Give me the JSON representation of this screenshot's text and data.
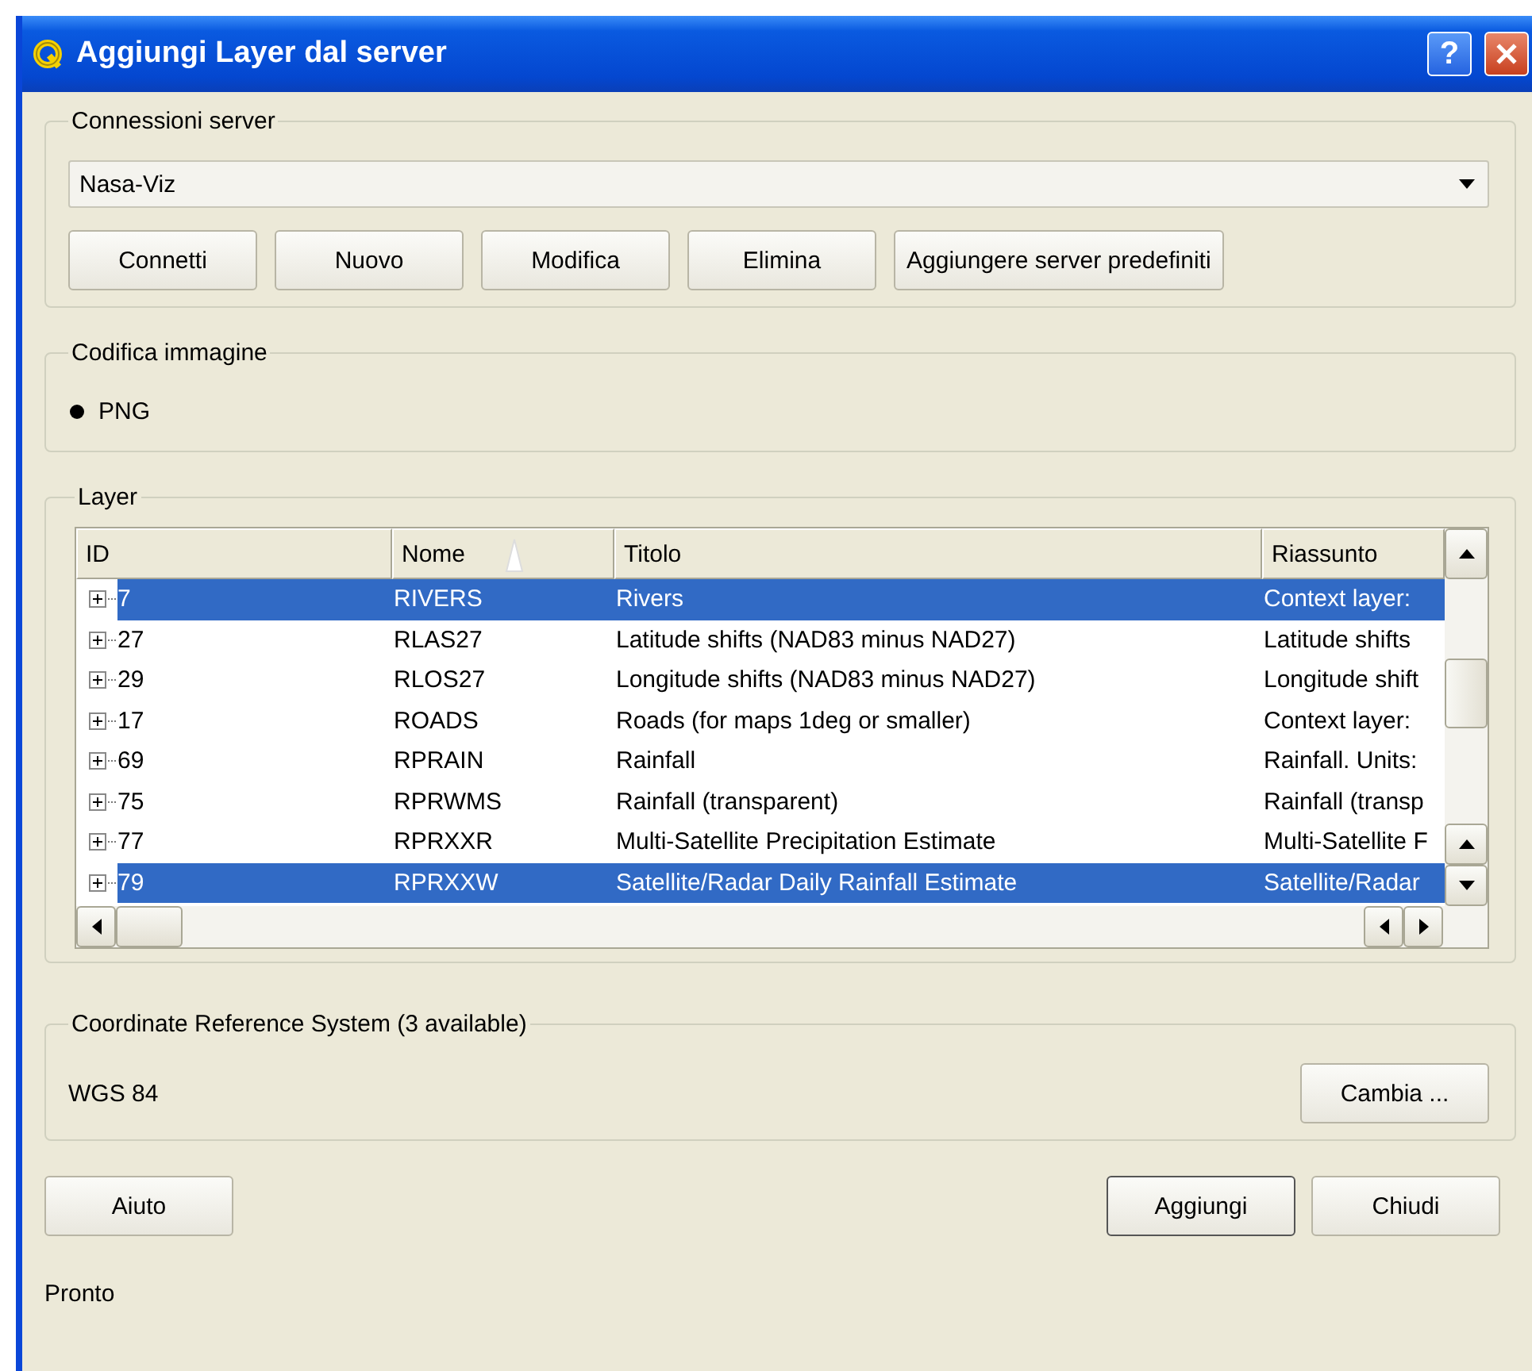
{
  "window": {
    "title": "Aggiungi Layer dal server",
    "help": "?"
  },
  "connections": {
    "label": "Connessioni server",
    "selected_server": "Nasa-Viz",
    "buttons": [
      "Connetti",
      "Nuovo",
      "Modifica",
      "Elimina",
      "Aggiungere server predefiniti"
    ]
  },
  "encoding": {
    "label": "Codifica immagine",
    "options": [
      {
        "label": "PNG",
        "selected": true
      }
    ]
  },
  "layers": {
    "label": "Layer",
    "columns": [
      "ID",
      "Nome",
      "Titolo",
      "Riassunto"
    ],
    "rows": [
      {
        "id": "7",
        "name": "RIVERS",
        "title": "Rivers",
        "summary": "Context layer:",
        "selected": true,
        "expanded": false
      },
      {
        "id": "27",
        "name": "RLAS27",
        "title": "Latitude shifts (NAD83 minus NAD27)",
        "summary": "Latitude shifts",
        "selected": false,
        "expanded": false
      },
      {
        "id": "29",
        "name": "RLOS27",
        "title": "Longitude shifts (NAD83 minus NAD27)",
        "summary": "Longitude shift",
        "selected": false,
        "expanded": false
      },
      {
        "id": "17",
        "name": "ROADS",
        "title": "Roads (for maps 1deg or smaller)",
        "summary": "Context layer:",
        "selected": false,
        "expanded": false
      },
      {
        "id": "69",
        "name": "RPRAIN",
        "title": "Rainfall",
        "summary": "Rainfall. Units:",
        "selected": false,
        "expanded": false
      },
      {
        "id": "75",
        "name": "RPRWMS",
        "title": "Rainfall (transparent)",
        "summary": "Rainfall (transp",
        "selected": false,
        "expanded": false
      },
      {
        "id": "77",
        "name": "RPRXXR",
        "title": "Multi-Satellite Precipitation Estimate",
        "summary": "Multi-Satellite F",
        "selected": false,
        "expanded": false
      },
      {
        "id": "79",
        "name": "RPRXXW",
        "title": "Satellite/Radar Daily Rainfall Estimate",
        "summary": "Satellite/Radar",
        "selected": true,
        "expanded": false
      }
    ]
  },
  "crs": {
    "label": "Coordinate Reference System (3 available)",
    "value": "WGS 84",
    "button": "Cambia ..."
  },
  "footer": {
    "buttons": [
      "Aiuto",
      "Aggiungi",
      "Chiudi"
    ]
  },
  "status_bar": "Pronto"
}
